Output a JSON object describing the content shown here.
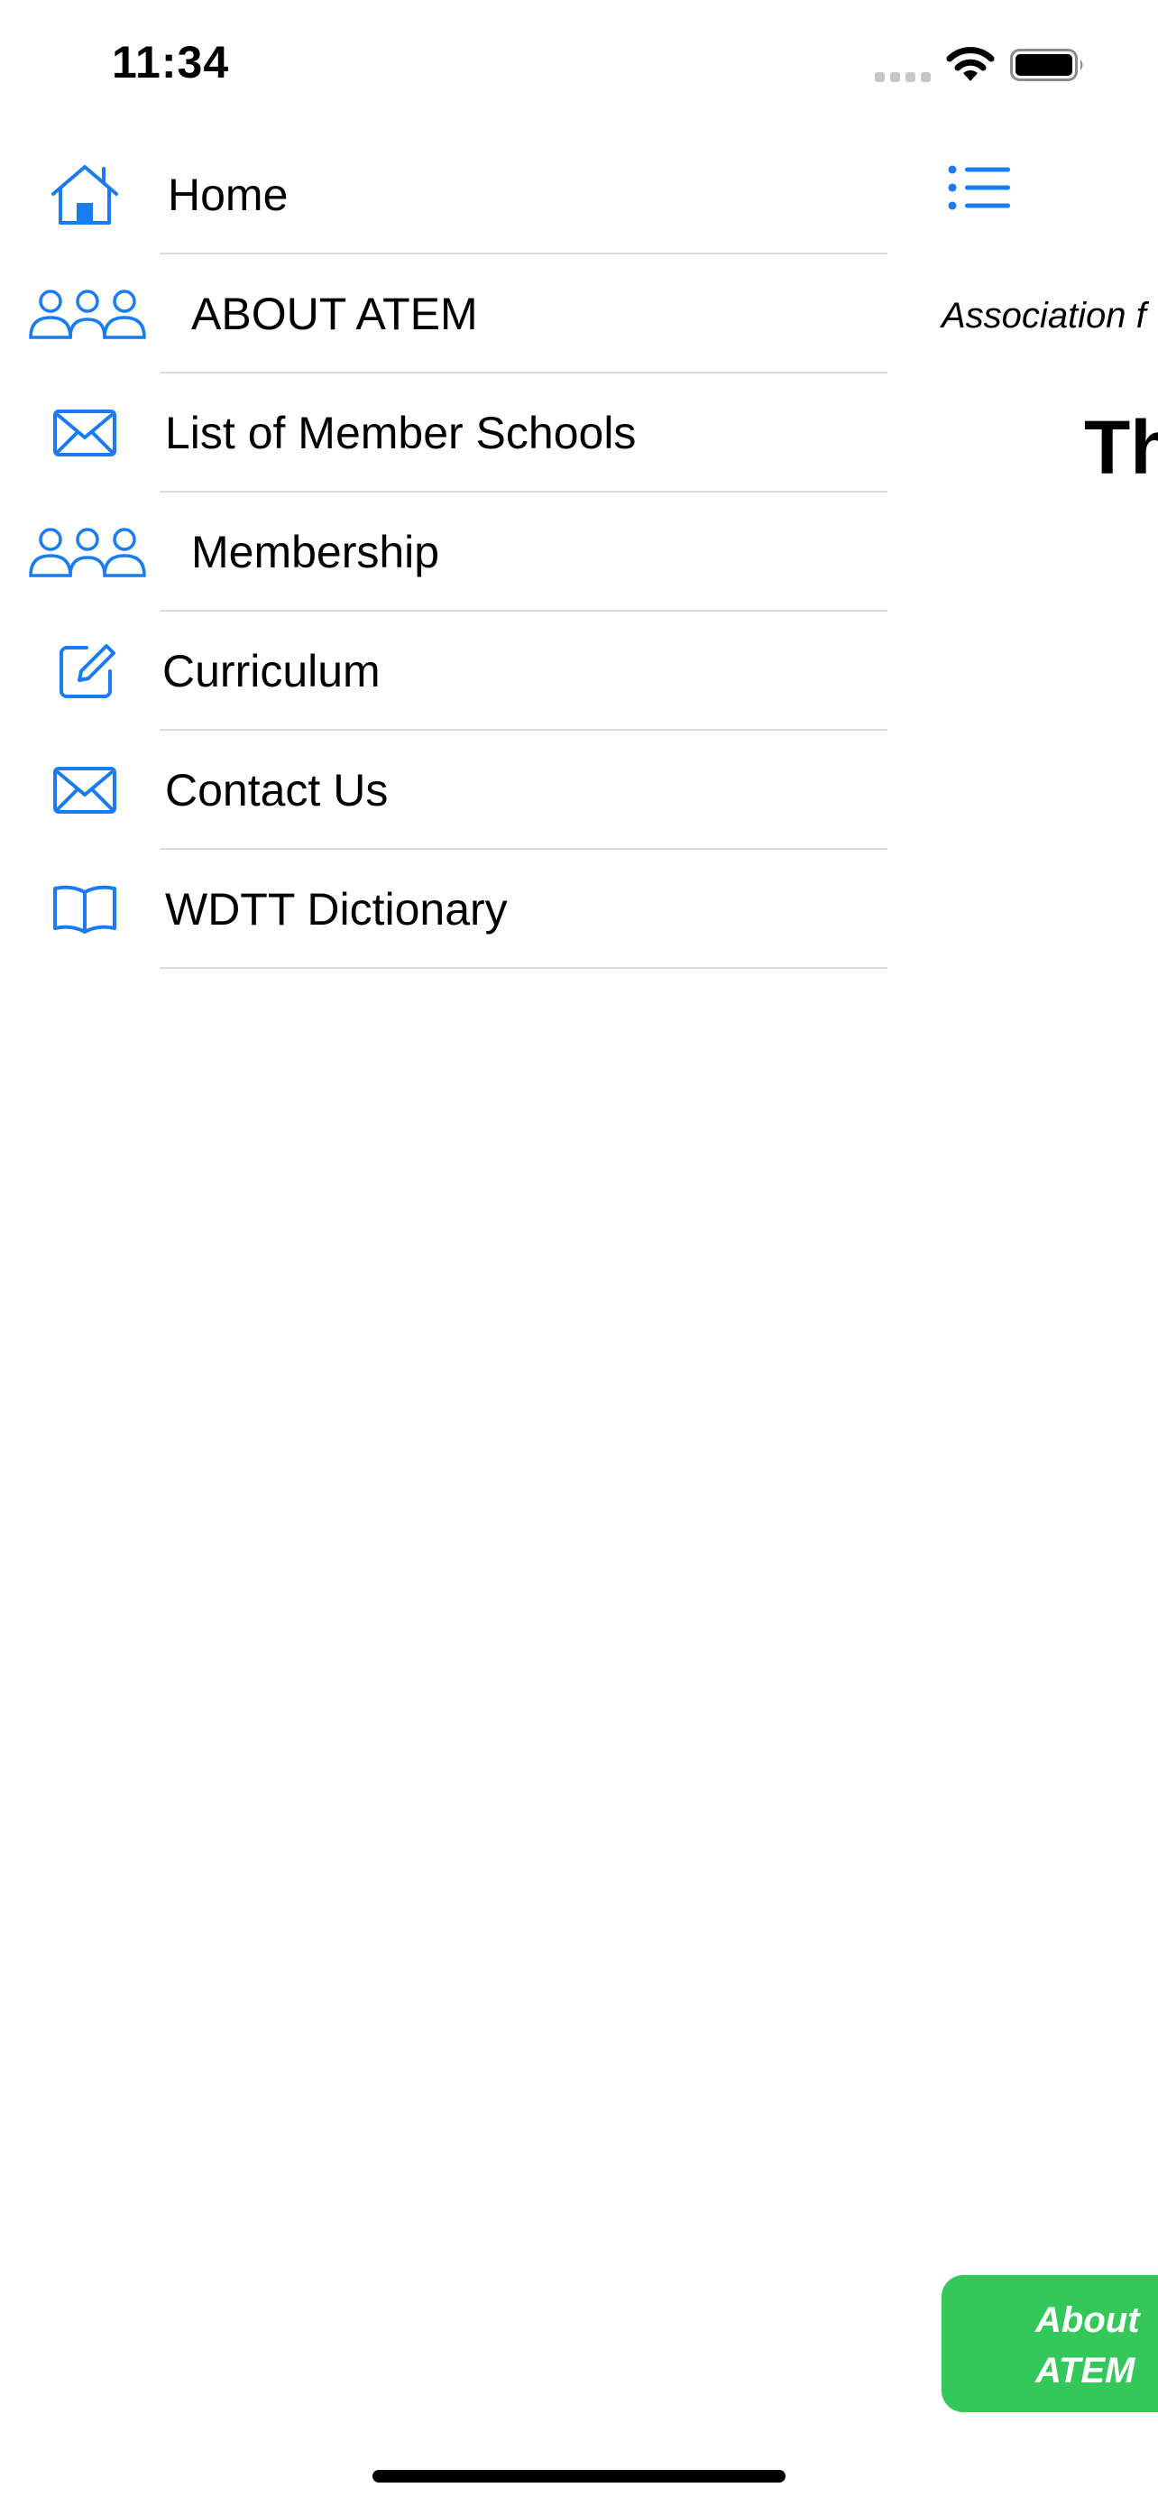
{
  "status_bar": {
    "time": "11:34"
  },
  "theme": {
    "accent": "#1a7cf2",
    "button_green": "#34c759",
    "divider": "#dcdcdc"
  },
  "menu": {
    "items": [
      {
        "label": "Home",
        "icon": "house-icon"
      },
      {
        "label": "ABOUT ATEM",
        "icon": "people-icon"
      },
      {
        "label": "List of Member Schools",
        "icon": "envelope-icon"
      },
      {
        "label": "Membership",
        "icon": "people-icon"
      },
      {
        "label": "Curriculum",
        "icon": "edit-icon"
      },
      {
        "label": "Contact Us",
        "icon": "envelope-icon"
      },
      {
        "label": "WDTT Dictionary",
        "icon": "book-icon"
      }
    ]
  },
  "main": {
    "list_button_icon": "list-icon",
    "subtitle": "Association f",
    "heading": "Th",
    "about_button": {
      "line1": "About",
      "line2": "ATEM"
    }
  }
}
